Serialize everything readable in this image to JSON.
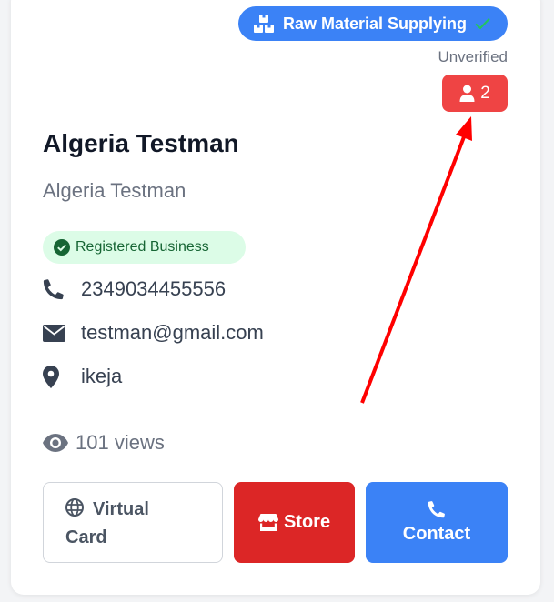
{
  "card": {
    "category_label": "Raw Material Supplying",
    "verification_status": "Unverified",
    "users_count": "2",
    "business_name": "Algeria Testman",
    "business_subtitle": "Algeria Testman",
    "registered_label": "Registered Business",
    "phone": "2349034455556",
    "email": "testman@gmail.com",
    "location": "ikeja",
    "views": "101 views"
  },
  "buttons": {
    "virtual_card_line1": "Virtual",
    "virtual_card_line2": "Card",
    "store": "Store",
    "contact": "Contact"
  },
  "icons": {
    "category": "boxes-icon",
    "category_check": "check-icon",
    "users": "user-icon",
    "registered": "check-circle-icon",
    "phone": "phone-icon",
    "email": "envelope-icon",
    "location": "map-pin-icon",
    "views": "eye-icon",
    "virtual_card": "globe-icon",
    "store": "store-icon",
    "contact": "phone-icon"
  },
  "colors": {
    "category_badge": "#3b82f6",
    "users_badge": "#ef4444",
    "registered_badge_bg": "#dcfce7",
    "registered_badge_text": "#166534",
    "store_button": "#dc2626",
    "contact_button": "#3b82f6",
    "annotation_arrow": "#ff0000"
  }
}
